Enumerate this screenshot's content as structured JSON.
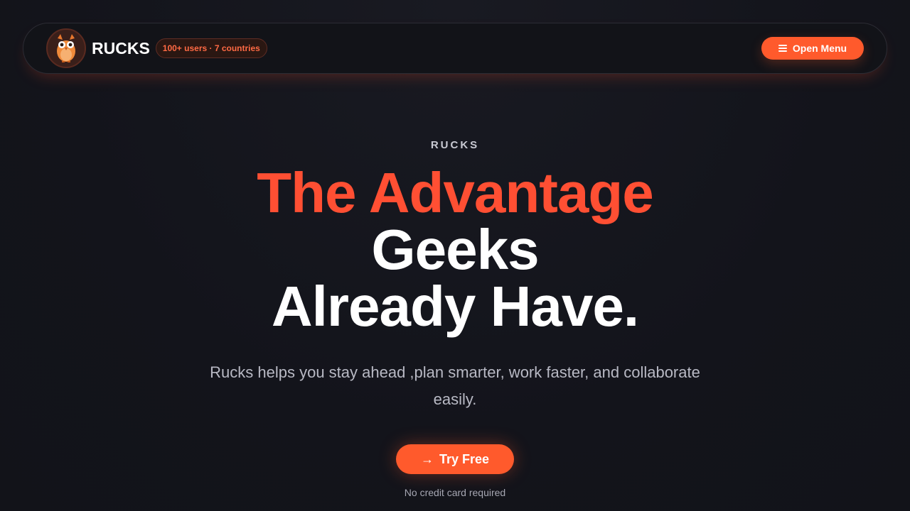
{
  "nav": {
    "brand": "RUCKS",
    "badge": "100+ users · 7 countries",
    "menu_label": "Open Menu",
    "logo_icon": "owl-icon",
    "menu_icon": "hamburger-icon"
  },
  "hero": {
    "eyebrow": "RUCKS",
    "line1": "The Advantage",
    "line2": "Geeks",
    "line3": "Already Have.",
    "subtitle": "Rucks helps you stay ahead ,plan smarter, work faster, and collaborate easily.",
    "cta_label": "Try Free",
    "cta_icon": "arrow-right-icon",
    "note": "No credit card required"
  },
  "colors": {
    "accent": "#ff5a2c",
    "headline_accent": "#ff4f33",
    "background": "#13141b"
  }
}
